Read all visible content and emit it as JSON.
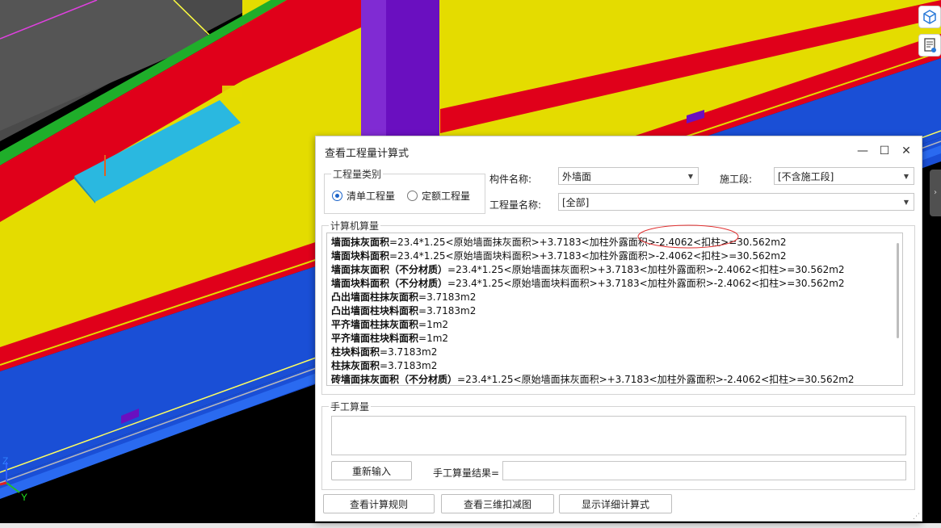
{
  "dialog": {
    "title": "查看工程量计算式",
    "category_group": "工程量类别",
    "radio_qingdan": "清单工程量",
    "radio_dinge": "定额工程量",
    "component_label": "构件名称:",
    "component_value": "外墙面",
    "stage_label": "施工段:",
    "stage_value": "[不含施工段]",
    "qty_name_label": "工程量名称:",
    "qty_name_value": "[全部]",
    "computer_group": "计算机算量",
    "lines": [
      {
        "name": "墙面抹灰面积",
        "formula": "=23.4*1.25<原始墙面抹灰面积>+3.7183<加柱外露面积>-2.4062<扣柱>=30.562m2"
      },
      {
        "name": "墙面块料面积",
        "formula": "=23.4*1.25<原始墙面块料面积>+3.7183<加柱外露面积>-2.4062<扣柱>=30.562m2"
      },
      {
        "name": "墙面抹灰面积（不分材质）",
        "formula": "=23.4*1.25<原始墙面抹灰面积>+3.7183<加柱外露面积>-2.4062<扣柱>=30.562m2"
      },
      {
        "name": "墙面块料面积（不分材质）",
        "formula": "=23.4*1.25<原始墙面块料面积>+3.7183<加柱外露面积>-2.4062<扣柱>=30.562m2"
      },
      {
        "name": "凸出墙面柱抹灰面积",
        "formula": "=3.7183m2"
      },
      {
        "name": "凸出墙面柱块料面积",
        "formula": "=3.7183m2"
      },
      {
        "name": "平齐墙面柱抹灰面积",
        "formula": "=1m2"
      },
      {
        "name": "平齐墙面柱块料面积",
        "formula": "=1m2"
      },
      {
        "name": "柱块料面积",
        "formula": "=3.7183m2"
      },
      {
        "name": "柱抹灰面积",
        "formula": "=3.7183m2"
      },
      {
        "name": "砖墙面抹灰面积（不分材质）",
        "formula": "=23.4*1.25<原始墙面抹灰面积>+3.7183<加柱外露面积>-2.4062<扣柱>=30.562m2"
      }
    ],
    "manual_group": "手工算量",
    "reenter_button": "重新输入",
    "manual_result_label": "手工算量结果=",
    "btn_rules": "查看计算规则",
    "btn_3d": "查看三维扣减图",
    "btn_detail": "显示详细计算式"
  },
  "axis": {
    "z": "Z",
    "y": "Y"
  },
  "colors": {
    "red": "#e0001a",
    "yellow": "#e4dc00",
    "blue": "#1a4fd6",
    "green": "#1fae2a",
    "purple": "#6a0fc0",
    "cyan": "#2ab8e0"
  }
}
